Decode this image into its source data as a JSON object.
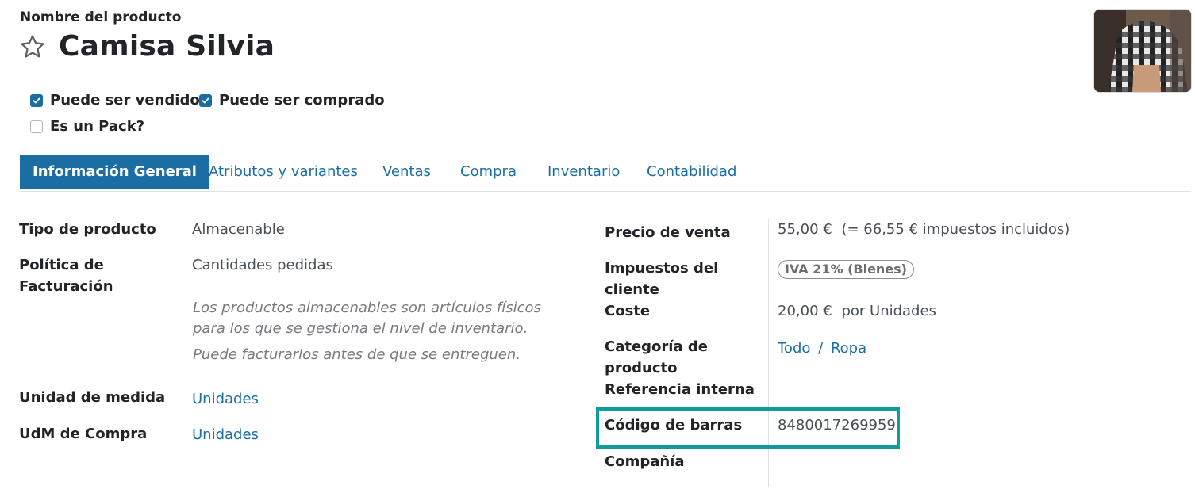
{
  "header": {
    "name_label": "Nombre del producto",
    "title": "Camisa Silvia",
    "favorite_icon": "star-outline-icon"
  },
  "checkboxes": {
    "can_be_sold": {
      "label": "Puede ser vendido",
      "checked": true
    },
    "can_be_purchased": {
      "label": "Puede ser comprado",
      "checked": true
    },
    "is_pack": {
      "label": "Es un Pack?",
      "checked": false
    }
  },
  "tabs": [
    {
      "label": "Información General",
      "active": true
    },
    {
      "label": "Atributos y variantes",
      "active": false
    },
    {
      "label": "Ventas",
      "active": false
    },
    {
      "label": "Compra",
      "active": false
    },
    {
      "label": "Inventario",
      "active": false
    },
    {
      "label": "Contabilidad",
      "active": false
    }
  ],
  "left": {
    "product_type": {
      "label": "Tipo de producto",
      "value": "Almacenable"
    },
    "invoicing_policy": {
      "label_line1": "Política de",
      "label_line2": "Facturación",
      "value": "Cantidades pedidas",
      "note1_line1": "Los productos almacenables son artículos físicos",
      "note1_line2": "para los que se gestiona el nivel de inventario.",
      "note2": "Puede facturarlos antes de que se entreguen."
    },
    "uom": {
      "label": "Unidad de medida",
      "value": "Unidades"
    },
    "purchase_uom": {
      "label": "UdM de Compra",
      "value": "Unidades"
    }
  },
  "right": {
    "sales_price": {
      "label": "Precio de venta",
      "value": "55,00 €",
      "tax_info": "(= 66,55 € impuestos incluidos)"
    },
    "customer_taxes": {
      "label_line1": "Impuestos del",
      "label_line2": "cliente",
      "badge": "IVA 21% (Bienes)"
    },
    "cost": {
      "label": "Coste",
      "value": "20,00 €",
      "unit": "por Unidades"
    },
    "category": {
      "label_line1": "Categoría de",
      "label_line2": "producto",
      "value_part1": "Todo",
      "separator": "/",
      "value_part2": "Ropa"
    },
    "internal_ref": {
      "label": "Referencia interna",
      "value": ""
    },
    "barcode": {
      "label": "Código de barras",
      "value": "8480017269959"
    },
    "company": {
      "label": "Compañía",
      "value": ""
    }
  },
  "colors": {
    "accent": "#1a6ea3",
    "highlight": "#0f9b9b"
  }
}
